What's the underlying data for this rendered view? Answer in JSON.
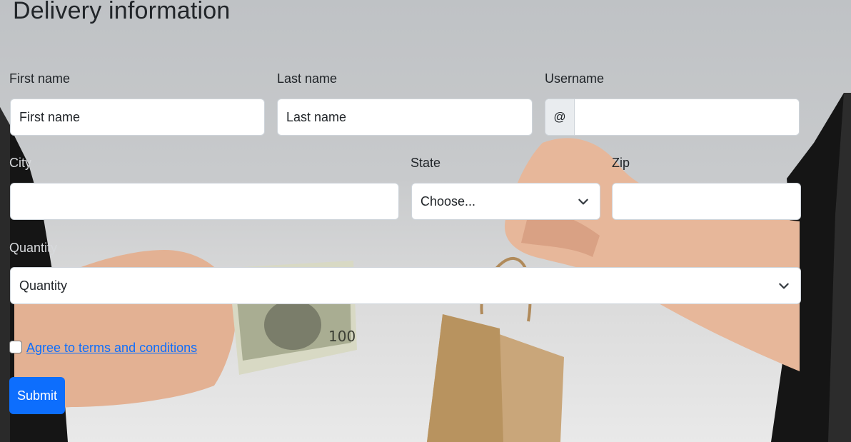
{
  "page": {
    "title": "Delivery information"
  },
  "form": {
    "first_name": {
      "label": "First name",
      "placeholder": "First name",
      "value": ""
    },
    "last_name": {
      "label": "Last name",
      "placeholder": "Last name",
      "value": ""
    },
    "username": {
      "label": "Username",
      "prefix": "@",
      "value": ""
    },
    "city": {
      "label": "City",
      "value": ""
    },
    "state": {
      "label": "State",
      "selected": "Choose..."
    },
    "zip": {
      "label": "Zip",
      "value": ""
    },
    "quantity": {
      "label": "Quantity",
      "selected": "Quantity"
    },
    "terms": {
      "label": "Agree to terms and conditions",
      "checked": false
    },
    "submit_label": "Submit"
  },
  "colors": {
    "primary": "#0d6efd",
    "link": "#0d6efd",
    "text": "#212529",
    "border": "#ced4da",
    "addon_bg": "#e9ecef"
  },
  "icons": {
    "select_arrow": "chevron-down-icon"
  }
}
